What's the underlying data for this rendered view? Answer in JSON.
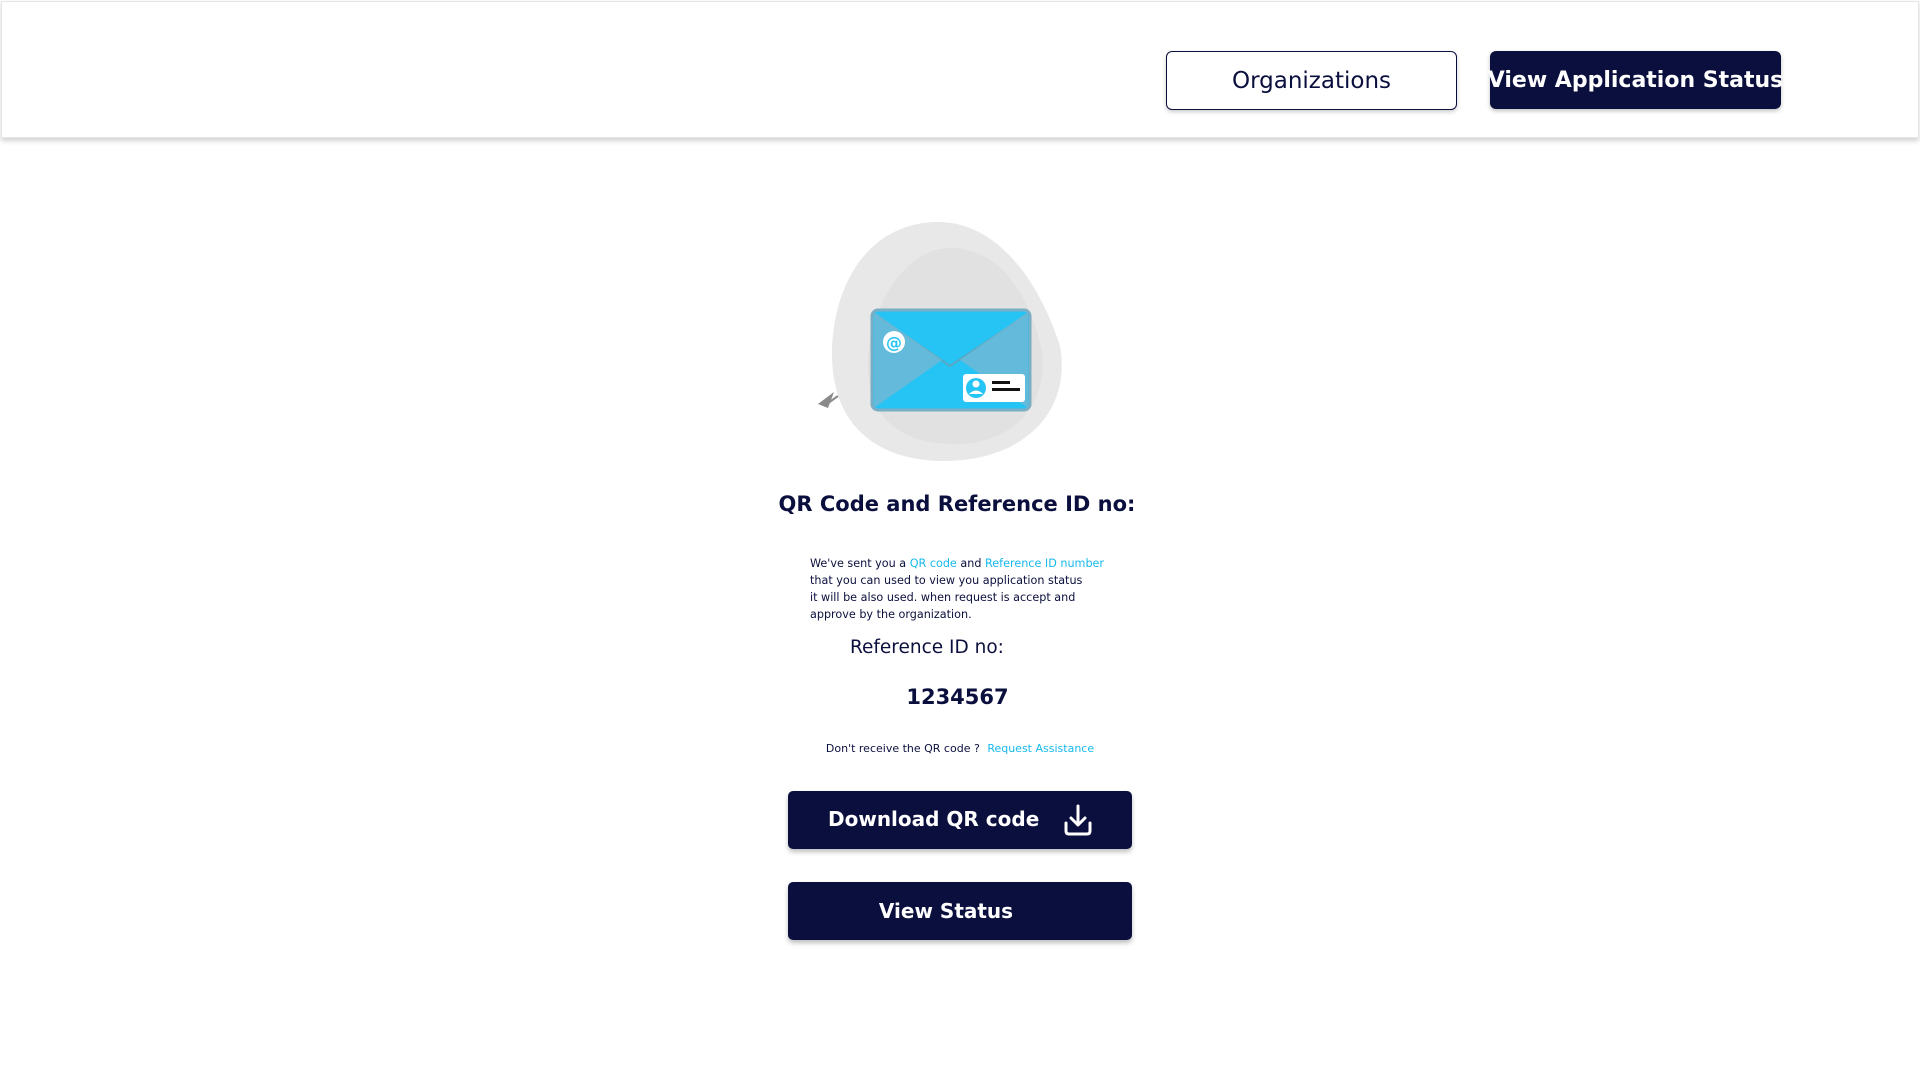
{
  "header": {
    "organizations_label": "Organizations",
    "view_application_status_label": "View Application Status"
  },
  "main": {
    "illustration_icon": "email-id-card-icon",
    "title": "QR Code and Reference ID no:",
    "description": {
      "part1": "We've sent you a ",
      "qr_link": "QR code",
      "part2": " and ",
      "ref_link": "Reference ID number",
      "line2": "that you can used to view you application status",
      "line3": "it will be also used. when request is accept and",
      "line4": "approve by the organization."
    },
    "reference_label": "Reference ID no:",
    "reference_value": "1234567",
    "assist_text": "Don't receive the QR code ?",
    "assist_link": "Request Assistance",
    "download_label": "Download QR code",
    "download_icon": "download-icon",
    "view_status_label": "View Status"
  },
  "colors": {
    "primary": "#0b0f3d",
    "accent": "#17b9ec",
    "blob": "#e6e6e6"
  }
}
